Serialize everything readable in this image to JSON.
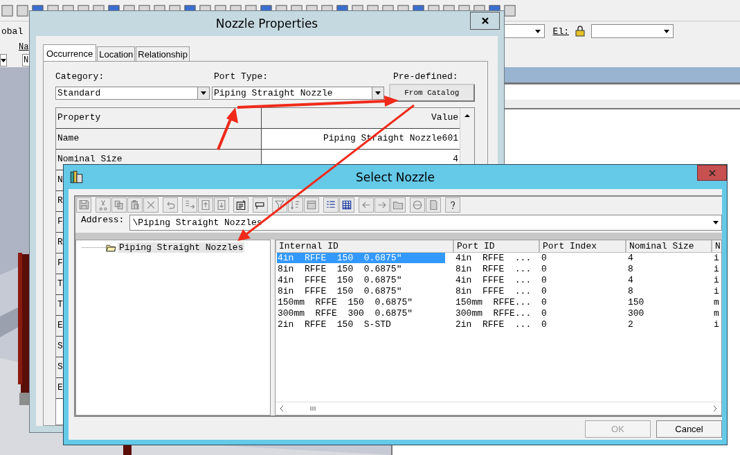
{
  "app": {
    "scope_field": "obal",
    "el_label": "El:",
    "name_label": "Na",
    "name_field": "N"
  },
  "nozzle_properties": {
    "title": "Nozzle Properties",
    "tabs": [
      {
        "label": "Occurrence",
        "selected": true
      },
      {
        "label": "Location",
        "selected": false
      },
      {
        "label": "Relationship",
        "selected": false
      }
    ],
    "category_label": "Category:",
    "category": "Standard",
    "port_type_label": "Port Type:",
    "port_type": "Piping Straight Nozzle",
    "predefined_label": "Pre-defined:",
    "catalog_button": "From Catalog",
    "grid": {
      "columns": [
        "Property",
        "Value"
      ],
      "rows": [
        {
          "property": "Name",
          "value": "Piping Straight Nozzle601"
        },
        {
          "property": "Nominal Size",
          "value": "4"
        },
        {
          "property": "N"
        },
        {
          "property": "R"
        },
        {
          "property": "F"
        },
        {
          "property": "R"
        },
        {
          "property": "F"
        },
        {
          "property": "T"
        },
        {
          "property": "T"
        },
        {
          "property": "E"
        },
        {
          "property": "S"
        },
        {
          "property": "S"
        },
        {
          "property": "E"
        }
      ]
    }
  },
  "select_nozzle": {
    "title": "Select Nozzle",
    "address_label": "Address:",
    "address": "\\Piping Straight Nozzles",
    "tree": [
      {
        "label": "Piping Straight Nozzles",
        "selected": true
      }
    ],
    "list": {
      "columns": [
        "Internal ID",
        "Port ID",
        "Port Index",
        "Nominal Size",
        "N"
      ],
      "rows": [
        {
          "cells": [
            "4in  RFFE  150  0.6875″",
            "4in  RFFE  ...",
            "0",
            "4",
            "i"
          ],
          "selected": true
        },
        {
          "cells": [
            "8in  RFFE  150  0.6875″",
            "8in  RFFE  ...",
            "0",
            "8",
            "i"
          ],
          "selected": false
        },
        {
          "cells": [
            "4in  FFFE  150  0.6875″",
            "4in  FFFE  ...",
            "0",
            "4",
            "i"
          ],
          "selected": false
        },
        {
          "cells": [
            "8in  FFFE  150  0.6875″",
            "8in  FFFE  ...",
            "0",
            "8",
            "i"
          ],
          "selected": false
        },
        {
          "cells": [
            "150mm  RFFE  150  0.6875″",
            "150mm  RFFE...",
            "0",
            "150",
            "m"
          ],
          "selected": false
        },
        {
          "cells": [
            "300mm  RFFE  300  0.6875″",
            "300mm  RFFE...",
            "0",
            "300",
            "m"
          ],
          "selected": false
        },
        {
          "cells": [
            "2in  RFFE  150  S-STD",
            "2in  RFFE  ...",
            "0",
            "2",
            "i"
          ],
          "selected": false
        }
      ]
    },
    "buttons": [
      {
        "label": "OK",
        "disabled": true
      },
      {
        "label": "Cancel",
        "disabled": false
      }
    ]
  }
}
